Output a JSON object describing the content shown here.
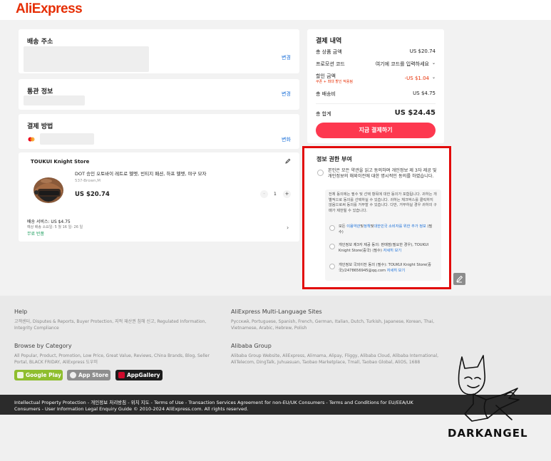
{
  "brand": {
    "logo": "AliExpress",
    "accent": "#e62e04"
  },
  "shipping": {
    "title": "배송 주소",
    "change": "변경"
  },
  "customs": {
    "title": "통관 정보",
    "change": "변경"
  },
  "payment": {
    "title": "결제 방법",
    "change": "변화"
  },
  "store": {
    "name": "TOUKUI Knight Store",
    "edit_icon": "pencil-icon",
    "product_title": "DOT 승인 오토바이 레트로 헬멧, 빈티지 패션, 하프 헬멧, 야구 모자",
    "variant": "537-Brown,M",
    "price": "US $20.74",
    "qty": "1",
    "minus": "-",
    "plus": "+",
    "shipping_service": "배송 서비스: US $4.75",
    "delivery_est": "예상 배송 소요일: 5 월 16 일- 26 일",
    "free_return": "무료 반품"
  },
  "summary": {
    "title": "결제 내역",
    "subtotal_label": "총 상품 금액",
    "subtotal_value": "US $20.74",
    "promo_label": "프로모션 코드",
    "promo_value": "여기에 코드를 입력하세요",
    "discount_label": "할인 금액",
    "discount_sub": "쿠폰 + 최대 할인 적용됨",
    "discount_value": "-US $1.04",
    "ship_label": "총 배송비",
    "ship_value": "US $4.75",
    "total_label": "총 합계",
    "total_value": "US $24.45",
    "pay_button": "지금 결제하기"
  },
  "consent": {
    "title": "정보 권한 부여",
    "main_text": "본인은 모든 약관을 읽고 동의하며 개인정보 제 3자 제공 및 개인정보의 해외이전에 대한 명시적인 동의를 하였습니다.",
    "box_text": "전체 동의에는 필수 및 선택 항목에 대한 동의가 포함됩니다. 귀하는 개별적으로 동의를 선택하실 수 있습니다. 귀하는 체크박스를 클릭하지 않음으로써 동의를 거부할 수 있습니다. 다만, 거부하실 경우 귀하의 구매가 제한될 수 있습니다.",
    "item1_pre": "모든 ",
    "item1_link": "이용약관",
    "item1_mid": "및",
    "item1_link2": "정책",
    "item1_mid2": "및",
    "item1_link3": "대한민국 소비자를 위한 추가 정보",
    "item1_post": " (필수)",
    "item2_text": "개인정보 제3자 제공 동의: 판매점(필요한 경우), TOUKUI Knight Store(중국) (필수)",
    "item2_link": "자세히 보기",
    "item3_text": "개인정보 국외이전 동의 (필수): TOUKUI Knight Store(중국)/2478656945@qq.com",
    "item3_link": "자세히 보기"
  },
  "footer": {
    "help_title": "Help",
    "help_text": "고객센터, Disputes & Reports, Buyer Protection, 지적 재산권 침해 신고, Regulated Information, Integrity Compliance",
    "lang_title": "AliExpress Multi-Language Sites",
    "lang_text": "Русский, Portuguese, Spanish, French, German, Italian, Dutch, Turkish, Japanese, Korean, Thai, Vietnamese, Arabic, Hebrew, Polish",
    "category_title": "Browse by Category",
    "category_text": "All Popular, Product, Promotion, Low Price, Great Value, Reviews, China Brands, Blog, Seller Portal, BLACK FRIDAY, AliExpress 도우미",
    "alibaba_title": "Alibaba Group",
    "alibaba_text": "Alibaba Group Website, AliExpress, Alimama, Alipay, Fliggy, Alibaba Cloud, Alibaba International, AliTelecom, DingTalk, Juhuasuan, Taobao Marketplace, Tmall, Taobao Global, AliOS, 1688",
    "google_play": "Google Play",
    "app_store": "App Store",
    "app_gallery": "AppGallery"
  },
  "legal": {
    "line1": "Intellectual Property Protection - 개인정보 처리방침 - 위치 지도 - Terms of Use - Transaction Services Agreement for non-EU/UK Consumers - Terms and Conditions for EU/EEA/UK",
    "line2": "Consumers - User Information Legal Enquiry Guide © 2010-2024 AliExpress.com. All rights reserved."
  },
  "watermark": {
    "text": "DARKANGEL"
  },
  "colors": {
    "pay_button": "#fd384f",
    "link": "#1a6fd8",
    "highlight_border": "#e20a0a",
    "discount": "#e62e04"
  }
}
